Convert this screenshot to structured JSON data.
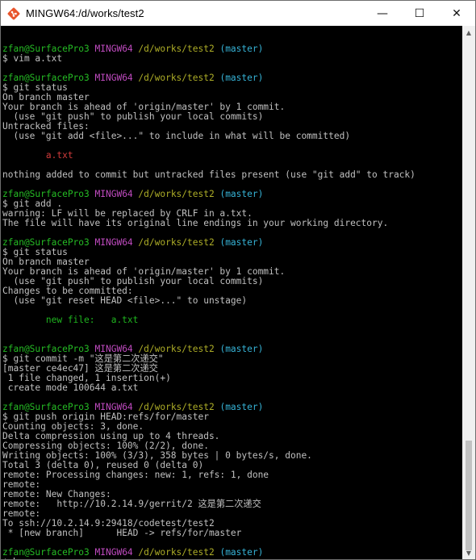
{
  "window": {
    "title": "MINGW64:/d/works/test2",
    "minimize_glyph": "—",
    "maximize_glyph": "☐",
    "close_glyph": "✕"
  },
  "colors": {
    "background": "#000000",
    "text": "#c0c0c0",
    "user_host": "#25bc24",
    "mingw": "#c04bc0",
    "path": "#adad27",
    "branch": "#36b3d6",
    "untracked": "#d03b3b",
    "staged": "#1fb51f"
  },
  "terminal": {
    "lines": [
      {
        "segs": []
      },
      {
        "segs": [
          {
            "t": "zfan@SurfacePro3 ",
            "c": "u"
          },
          {
            "t": "MINGW64 ",
            "c": "h"
          },
          {
            "t": "/d/works/test2 ",
            "c": "p"
          },
          {
            "t": "(master)",
            "c": "b"
          }
        ]
      },
      {
        "segs": [
          {
            "t": "$ vim a.txt",
            "c": "w"
          }
        ]
      },
      {
        "segs": []
      },
      {
        "segs": [
          {
            "t": "zfan@SurfacePro3 ",
            "c": "u"
          },
          {
            "t": "MINGW64 ",
            "c": "h"
          },
          {
            "t": "/d/works/test2 ",
            "c": "p"
          },
          {
            "t": "(master)",
            "c": "b"
          }
        ]
      },
      {
        "segs": [
          {
            "t": "$ git status",
            "c": "w"
          }
        ]
      },
      {
        "segs": [
          {
            "t": "On branch master",
            "c": "w"
          }
        ]
      },
      {
        "segs": [
          {
            "t": "Your branch is ahead of 'origin/master' by 1 commit.",
            "c": "w"
          }
        ]
      },
      {
        "segs": [
          {
            "t": "  (use \"git push\" to publish your local commits)",
            "c": "w"
          }
        ]
      },
      {
        "segs": [
          {
            "t": "Untracked files:",
            "c": "w"
          }
        ]
      },
      {
        "segs": [
          {
            "t": "  (use \"git add <file>...\" to include in what will be committed)",
            "c": "w"
          }
        ]
      },
      {
        "segs": []
      },
      {
        "segs": [
          {
            "t": "        a.txt",
            "c": "r"
          }
        ]
      },
      {
        "segs": []
      },
      {
        "segs": [
          {
            "t": "nothing added to commit but untracked files present (use \"git add\" to track)",
            "c": "w"
          }
        ]
      },
      {
        "segs": []
      },
      {
        "segs": [
          {
            "t": "zfan@SurfacePro3 ",
            "c": "u"
          },
          {
            "t": "MINGW64 ",
            "c": "h"
          },
          {
            "t": "/d/works/test2 ",
            "c": "p"
          },
          {
            "t": "(master)",
            "c": "b"
          }
        ]
      },
      {
        "segs": [
          {
            "t": "$ git add .",
            "c": "w"
          }
        ]
      },
      {
        "segs": [
          {
            "t": "warning: LF will be replaced by CRLF in a.txt.",
            "c": "w"
          }
        ]
      },
      {
        "segs": [
          {
            "t": "The file will have its original line endings in your working directory.",
            "c": "w"
          }
        ]
      },
      {
        "segs": []
      },
      {
        "segs": [
          {
            "t": "zfan@SurfacePro3 ",
            "c": "u"
          },
          {
            "t": "MINGW64 ",
            "c": "h"
          },
          {
            "t": "/d/works/test2 ",
            "c": "p"
          },
          {
            "t": "(master)",
            "c": "b"
          }
        ]
      },
      {
        "segs": [
          {
            "t": "$ git status",
            "c": "w"
          }
        ]
      },
      {
        "segs": [
          {
            "t": "On branch master",
            "c": "w"
          }
        ]
      },
      {
        "segs": [
          {
            "t": "Your branch is ahead of 'origin/master' by 1 commit.",
            "c": "w"
          }
        ]
      },
      {
        "segs": [
          {
            "t": "  (use \"git push\" to publish your local commits)",
            "c": "w"
          }
        ]
      },
      {
        "segs": [
          {
            "t": "Changes to be committed:",
            "c": "w"
          }
        ]
      },
      {
        "segs": [
          {
            "t": "  (use \"git reset HEAD <file>...\" to unstage)",
            "c": "w"
          }
        ]
      },
      {
        "segs": []
      },
      {
        "segs": [
          {
            "t": "        new file:   a.txt",
            "c": "g"
          }
        ]
      },
      {
        "segs": []
      },
      {
        "segs": []
      },
      {
        "segs": [
          {
            "t": "zfan@SurfacePro3 ",
            "c": "u"
          },
          {
            "t": "MINGW64 ",
            "c": "h"
          },
          {
            "t": "/d/works/test2 ",
            "c": "p"
          },
          {
            "t": "(master)",
            "c": "b"
          }
        ]
      },
      {
        "segs": [
          {
            "t": "$ git commit -m \"这是第二次递交\"",
            "c": "w"
          }
        ]
      },
      {
        "segs": [
          {
            "t": "[master ce4ec47] 这是第二次递交",
            "c": "w"
          }
        ]
      },
      {
        "segs": [
          {
            "t": " 1 file changed, 1 insertion(+)",
            "c": "w"
          }
        ]
      },
      {
        "segs": [
          {
            "t": " create mode 100644 a.txt",
            "c": "w"
          }
        ]
      },
      {
        "segs": []
      },
      {
        "segs": [
          {
            "t": "zfan@SurfacePro3 ",
            "c": "u"
          },
          {
            "t": "MINGW64 ",
            "c": "h"
          },
          {
            "t": "/d/works/test2 ",
            "c": "p"
          },
          {
            "t": "(master)",
            "c": "b"
          }
        ]
      },
      {
        "segs": [
          {
            "t": "$ git push origin HEAD:refs/for/master",
            "c": "w"
          }
        ]
      },
      {
        "segs": [
          {
            "t": "Counting objects: 3, done.",
            "c": "w"
          }
        ]
      },
      {
        "segs": [
          {
            "t": "Delta compression using up to 4 threads.",
            "c": "w"
          }
        ]
      },
      {
        "segs": [
          {
            "t": "Compressing objects: 100% (2/2), done.",
            "c": "w"
          }
        ]
      },
      {
        "segs": [
          {
            "t": "Writing objects: 100% (3/3), 358 bytes | 0 bytes/s, done.",
            "c": "w"
          }
        ]
      },
      {
        "segs": [
          {
            "t": "Total 3 (delta 0), reused 0 (delta 0)",
            "c": "w"
          }
        ]
      },
      {
        "segs": [
          {
            "t": "remote: Processing changes: new: 1, refs: 1, done",
            "c": "w"
          }
        ]
      },
      {
        "segs": [
          {
            "t": "remote:",
            "c": "w"
          }
        ]
      },
      {
        "segs": [
          {
            "t": "remote: New Changes:",
            "c": "w"
          }
        ]
      },
      {
        "segs": [
          {
            "t": "remote:   http://10.2.14.9/gerrit/2 这是第二次递交",
            "c": "w"
          }
        ]
      },
      {
        "segs": [
          {
            "t": "remote:",
            "c": "w"
          }
        ]
      },
      {
        "segs": [
          {
            "t": "To ssh://10.2.14.9:29418/codetest/test2",
            "c": "w"
          }
        ]
      },
      {
        "segs": [
          {
            "t": " * [new branch]      HEAD -> refs/for/master",
            "c": "w"
          }
        ]
      },
      {
        "segs": []
      },
      {
        "segs": [
          {
            "t": "zfan@SurfacePro3 ",
            "c": "u"
          },
          {
            "t": "MINGW64 ",
            "c": "h"
          },
          {
            "t": "/d/works/test2 ",
            "c": "p"
          },
          {
            "t": "(master)",
            "c": "b"
          }
        ]
      },
      {
        "segs": [
          {
            "t": "$ ",
            "c": "w"
          }
        ],
        "cursor": true
      }
    ]
  }
}
